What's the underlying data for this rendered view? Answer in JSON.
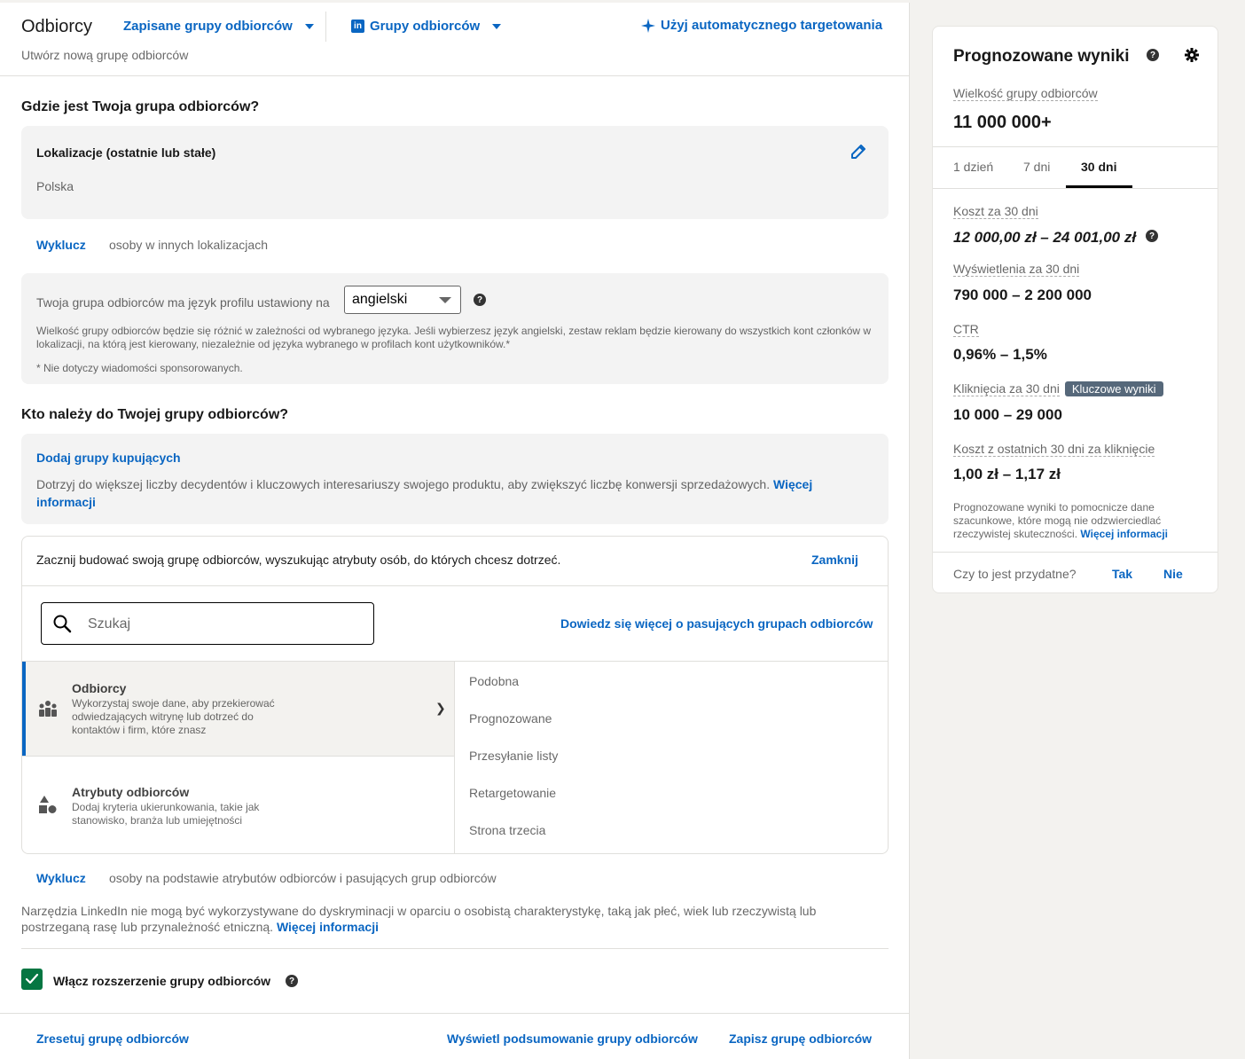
{
  "header": {
    "title": "Odbiorcy",
    "saved_groups": "Zapisane grupy odbiorców",
    "groups": "Grupy odbiorców",
    "auto_targeting": "Użyj automatycznego targetowania",
    "subtitle": "Utwórz nową grupę odbiorców"
  },
  "location_section": {
    "heading": "Gdzie jest Twoja grupa odbiorców?",
    "box_title": "Lokalizacje (ostatnie lub stałe)",
    "value": "Polska",
    "exclude_label": "Wyklucz",
    "exclude_text": "osoby w innych lokalizacjach"
  },
  "language": {
    "label": "Twoja grupa odbiorców ma język profilu ustawiony na",
    "selected": "angielski",
    "note": "Wielkość grupy odbiorców będzie się różnić w zależności od wybranego języka. Jeśli wybierzesz język angielski, zestaw reklam będzie kierowany do wszystkich kont członków w lokalizacji, na którą jest kierowany, niezależnie od języka wybranego w profilach kont użytkowników.*",
    "footnote": "* Nie dotyczy wiadomości sponsorowanych."
  },
  "who_section": {
    "heading": "Kto należy do Twojej grupy odbiorców?",
    "buyer_link": "Dodaj grupy kupujących",
    "buyer_text": "Dotrzyj do większej liczby decydentów i kluczowych interesariuszy swojego produktu, aby zwiększyć liczbę konwersji sprzedażowych.",
    "buyer_more": "Więcej informacji"
  },
  "builder": {
    "intro": "Zacznij budować swoją grupę odbiorców, wyszukując atrybuty osób, do których chcesz dotrzeć.",
    "close": "Zamknij",
    "search_placeholder": "Szukaj",
    "learn_more": "Dowiedz się więcej o pasujących grupach odbiorców",
    "categories": [
      {
        "title": "Odbiorcy",
        "desc": "Wykorzystaj swoje dane, aby przekierować odwiedzających witrynę lub dotrzeć do kontaktów i firm, które znasz",
        "chevron": "❯"
      },
      {
        "title": "Atrybuty odbiorców",
        "desc": "Dodaj kryteria ukierunkowania, takie jak stanowisko, branża lub umiejętności"
      }
    ],
    "subitems": [
      "Podobna",
      "Prognozowane",
      "Przesyłanie listy",
      "Retargetowanie",
      "Strona trzecia"
    ]
  },
  "exclude2": {
    "label": "Wyklucz",
    "text": "osoby na podstawie atrybutów odbiorców i pasujących grup odbiorców"
  },
  "disclaimer": {
    "text": "Narzędzia LinkedIn nie mogą być wykorzystywane do dyskryminacji w oparciu o osobistą charakterystykę, taką jak płeć, wiek lub rzeczywistą lub postrzeganą rasę lub przynależność etniczną.",
    "more": "Więcej informacji"
  },
  "expansion": {
    "label": "Włącz rozszerzenie grupy odbiorców",
    "checked": true
  },
  "footer": {
    "reset": "Zresetuj grupę odbiorców",
    "summary": "Wyświetl podsumowanie grupy odbiorców",
    "save": "Zapisz grupę odbiorców"
  },
  "forecast": {
    "title": "Prognozowane wyniki",
    "size_label": "Wielkość grupy odbiorców",
    "size_value": "11 000 000+",
    "tabs": [
      "1 dzień",
      "7 dni",
      "30 dni"
    ],
    "active_tab": "30 dni",
    "cost_label": "Koszt za 30 dni",
    "cost_value": "12 000,00 zł – 24 001,00 zł",
    "impr_label": "Wyświetlenia za 30 dni",
    "impr_value": "790 000 – 2 200 000",
    "ctr_label": "CTR",
    "ctr_value": "0,96% – 1,5%",
    "clicks_label": "Kliknięcia za 30 dni",
    "clicks_badge": "Kluczowe wyniki",
    "clicks_value": "10 000 – 29 000",
    "cpc_label": "Koszt z ostatnich 30 dni za kliknięcie",
    "cpc_value": "1,00 zł – 1,17 zł",
    "note": "Prognozowane wyniki to pomocnicze dane szacunkowe, które mogą nie odzwierciedlać rzeczywistej skuteczności.",
    "note_more": "Więcej informacji",
    "helpful_q": "Czy to jest przydatne?",
    "yes": "Tak",
    "no": "Nie"
  },
  "colors": {
    "accent": "#0a66c2",
    "check": "#057642",
    "badge": "#56687a"
  }
}
